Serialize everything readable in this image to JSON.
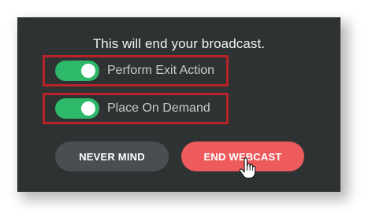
{
  "dialog": {
    "message": "This will end your broadcast.",
    "toggles": [
      {
        "label": "Perform Exit Action",
        "state": "on"
      },
      {
        "label": "Place On Demand",
        "state": "on"
      }
    ],
    "buttons": {
      "cancel_label": "NEVER MIND",
      "confirm_label": "END WEBCAST"
    }
  },
  "colors": {
    "dialog_background": "#2f3233",
    "toggle_on": "#2db86a",
    "highlight_border": "#b8232a",
    "cancel_button": "#4a4e52",
    "confirm_button": "#ee5b5d"
  },
  "icons": {
    "cursor": "hand-pointer-icon"
  }
}
